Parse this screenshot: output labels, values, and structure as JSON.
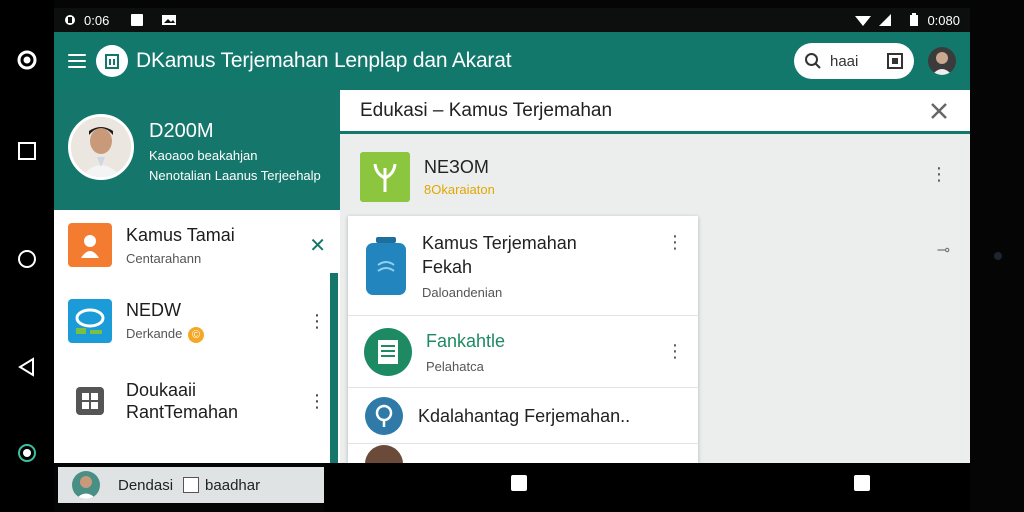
{
  "status_bar": {
    "time_left": "0:06",
    "time_right": "0:080"
  },
  "app_bar": {
    "title": "Kamus Terjemahan Lenplap dan Akarat",
    "title_prefix": "D",
    "search_text": "haai"
  },
  "drawer": {
    "user_name": "D200M",
    "user_line1": "Kaoaoo beakahjan",
    "user_line2": "Nenotalian Laanus Terjeehalp",
    "items": [
      {
        "label": "Kamus Tamai",
        "sublabel": "Centarahann",
        "action": "✕"
      },
      {
        "label": "NEDW",
        "sublabel": "Derkande",
        "badge": "©",
        "action": "⋮"
      },
      {
        "label": "Doukaaii",
        "label2": "RantTemahan",
        "action": "⋮"
      }
    ],
    "peek_label": "Dendasi",
    "peek_label2": "baadhar"
  },
  "content": {
    "header_title": "Edukasi – Kamus Terjemahan",
    "featured": {
      "title": "NEЗOM",
      "subtitle": "8Okaraiaton",
      "action": "⋮"
    },
    "side_mark": "⊸",
    "list": [
      {
        "title": "Kamus Terjemahan",
        "title2": "Fekah",
        "subtitle": "Daloandenian",
        "action": "⋮"
      },
      {
        "title": "Fankahtle",
        "subtitle": "Pelahatca",
        "action": "⋮"
      },
      {
        "title": "Kdalahantag Ferjemahan..",
        "action": ""
      }
    ]
  },
  "colors": {
    "primary": "#12786c",
    "accent_green": "#8cc63f",
    "accent_orange": "#f47c30",
    "accent_blue": "#1b7fb8",
    "accent_yellow": "#e0a800"
  },
  "icons": {
    "system_nav": [
      "radio-icon",
      "square-icon",
      "circle-icon",
      "back-triangle-icon",
      "dot-circle-icon"
    ],
    "status_bar": [
      "record-icon",
      "square-icon",
      "image-icon",
      "wifi-icon",
      "signal-icon",
      "battery-icon"
    ]
  }
}
